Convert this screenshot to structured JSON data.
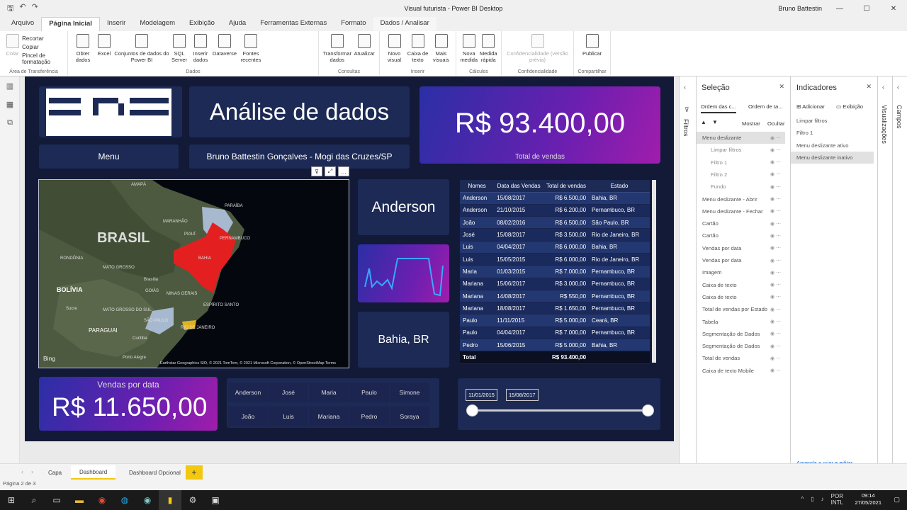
{
  "window": {
    "title": "Visual futurista - Power BI Desktop",
    "user": "Bruno Battestin",
    "user_initials": "BB"
  },
  "tabs": [
    "Arquivo",
    "Página Inicial",
    "Inserir",
    "Modelagem",
    "Exibição",
    "Ajuda",
    "Ferramentas Externas",
    "Formato",
    "Dados / Analisar"
  ],
  "ribbon": {
    "clipboard": {
      "paste": "Colar",
      "cut": "Recortar",
      "copy": "Copiar",
      "format_painter": "Pincel de formatação",
      "group": "Área de Transferência"
    },
    "data": {
      "get_data": "Obter dados",
      "excel": "Excel",
      "pbi_datasets": "Conjuntos de dados do Power BI",
      "sql": "SQL Server",
      "enter_data": "Inserir dados",
      "dataverse": "Dataverse",
      "recent": "Fontes recentes",
      "group": "Dados"
    },
    "queries": {
      "transform": "Transformar dados",
      "refresh": "Atualizar",
      "group": "Consultas"
    },
    "insert": {
      "new_visual": "Novo visual",
      "text_box": "Caixa de texto",
      "more_visuals": "Mais visuais",
      "group": "Inserir"
    },
    "calc": {
      "new_measure": "Nova medida",
      "quick_measure": "Medida rápida",
      "group": "Cálculos"
    },
    "sensitivity": {
      "label": "Confidencialidade (versão prévia)",
      "group": "Confidencialidade"
    },
    "share": {
      "publish": "Publicar",
      "group": "Compartilhar"
    }
  },
  "report": {
    "heading": "Análise de dados",
    "menu_button": "Menu",
    "author": "Bruno Battestin Gonçalves - Mogi das Cruzes/SP",
    "total_value": "R$ 93.400,00",
    "total_label": "Total de vendas",
    "person_card": "Anderson",
    "state_card": "Bahia, BR",
    "date_sales_label": "Vendas por data",
    "date_sales_value": "R$ 11.650,00",
    "map": {
      "country": "BRASIL",
      "labels": [
        "AMAPÁ",
        "PARAÍBA",
        "PERNAMBUCO",
        "MARANHÃO",
        "PIAUÍ",
        "BAHIA",
        "RONDÔNIA",
        "MATO GROSSO",
        "Brasília",
        "BOLÍVIA",
        "GOIÁS",
        "MINAS GERAIS",
        "ESPÍRITO SANTO",
        "Sucre",
        "MATO GROSSO DO SUL",
        "SÃO PAULO",
        "PARAGUAI",
        "RIO DE JANEIRO",
        "Curitiba",
        "Porto Alegre"
      ],
      "bing": "Bing",
      "credits": "Earthstar Geographics SIO, © 2021 TomTom, © 2021 Microsoft Corporation, © OpenStreetMap Terms"
    },
    "table": {
      "headers": [
        "Nomes",
        "Data das Vendas",
        "Total de vendas",
        "Estado"
      ],
      "rows": [
        [
          "Anderson",
          "15/08/2017",
          "R$ 6.500,00",
          "Bahia, BR"
        ],
        [
          "Anderson",
          "21/10/2015",
          "R$ 6.200,00",
          "Pernambuco, BR"
        ],
        [
          "João",
          "08/02/2016",
          "R$ 6.500,00",
          "São Paulo, BR"
        ],
        [
          "José",
          "15/08/2017",
          "R$ 3.500,00",
          "Rio de Janeiro, BR"
        ],
        [
          "Luis",
          "04/04/2017",
          "R$ 6.000,00",
          "Bahia, BR"
        ],
        [
          "Luis",
          "15/05/2015",
          "R$ 6.000,00",
          "Rio de Janeiro, BR"
        ],
        [
          "Maria",
          "01/03/2015",
          "R$ 7.000,00",
          "Pernambuco, BR"
        ],
        [
          "Mariana",
          "15/06/2017",
          "R$ 3.000,00",
          "Pernambuco, BR"
        ],
        [
          "Mariana",
          "14/08/2017",
          "R$ 550,00",
          "Pernambuco, BR"
        ],
        [
          "Mariana",
          "18/08/2017",
          "R$ 1.650,00",
          "Pernambuco, BR"
        ],
        [
          "Paulo",
          "11/11/2015",
          "R$ 5.000,00",
          "Ceará, BR"
        ],
        [
          "Paulo",
          "04/04/2017",
          "R$ 7.000,00",
          "Pernambuco, BR"
        ],
        [
          "Pedro",
          "15/06/2015",
          "R$ 5.000,00",
          "Bahia, BR"
        ]
      ],
      "total_label": "Total",
      "total_value": "R$ 93.400,00"
    },
    "names": [
      "Anderson",
      "José",
      "Maria",
      "Paulo",
      "Simone",
      "João",
      "Luis",
      "Mariana",
      "Pedro",
      "Soraya"
    ],
    "date_from": "11/01/2015",
    "date_to": "15/08/2017"
  },
  "panes": {
    "filters": "Filtros",
    "visualizations": "Visualizações",
    "fields": "Campos",
    "selection": {
      "title": "Seleção",
      "order_layer": "Ordem das c...",
      "order_tab": "Ordem de ta...",
      "show": "Mostrar",
      "hide": "Ocultar",
      "items": [
        "Menu deslizante",
        "Limpar filtros",
        "Filtro 1",
        "Filtro 2",
        "Fundo",
        "Menu deslizante - Abrir",
        "Menu deslizante - Fechar",
        "Cartão",
        "Cartão",
        "Vendas por data",
        "Vendas por data",
        "Imagem",
        "Caixa de texto",
        "Caixa de texto",
        "Total de vendas por Estado",
        "Tabela",
        "Segmentação de Dados",
        "Segmentação de Dados",
        "Total de vendas",
        "Caixa de texto Mobile"
      ]
    },
    "bookmarks": {
      "title": "Indicadores",
      "add": "Adicionar",
      "view": "Exibição",
      "items": [
        "Limpar filtros",
        "Filtro 1",
        "Menu deslizante ativo",
        "Menu deslizante inativo"
      ],
      "learn": "Aprenda a criar e editar indicadores"
    }
  },
  "pages": [
    "Capa",
    "Dashboard",
    "Dashboard Opcional"
  ],
  "status": "Página 2 de 3",
  "taskbar": {
    "lang1": "POR",
    "lang2": "INTL",
    "time": "09:14",
    "date": "27/05/2021"
  }
}
